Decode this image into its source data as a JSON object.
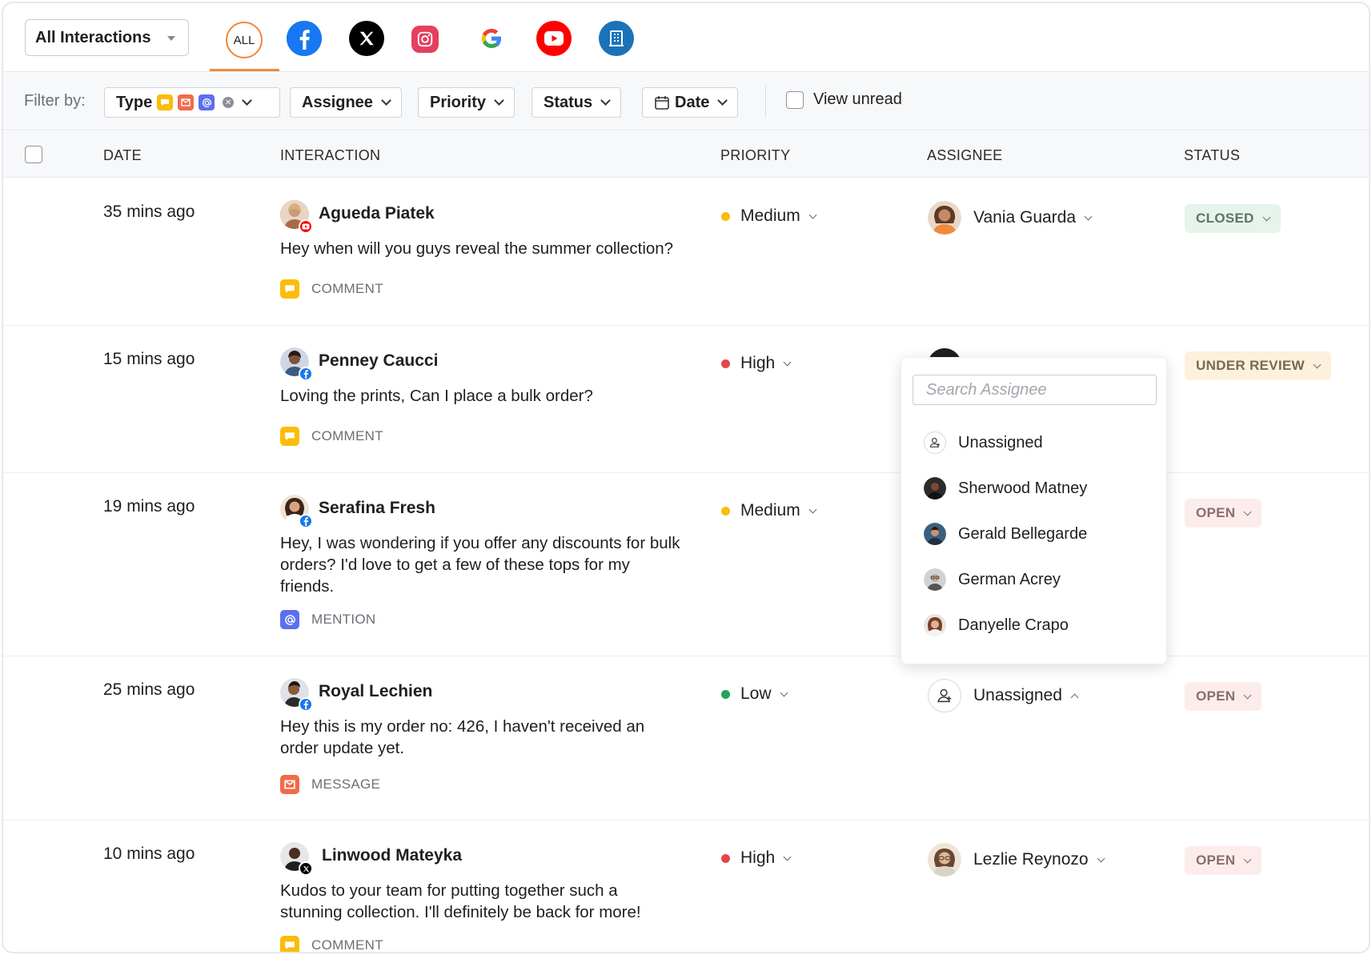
{
  "topbar": {
    "view_select": "All Interactions",
    "channels": [
      {
        "name": "all",
        "label": "ALL"
      },
      {
        "name": "facebook-icon"
      },
      {
        "name": "x-twitter-icon"
      },
      {
        "name": "instagram-icon"
      },
      {
        "name": "google-icon"
      },
      {
        "name": "youtube-icon"
      },
      {
        "name": "building-icon"
      }
    ]
  },
  "filters": {
    "label": "Filter by:",
    "type": "Type",
    "assignee": "Assignee",
    "priority": "Priority",
    "status": "Status",
    "date": "Date",
    "view_unread": "View unread"
  },
  "table": {
    "columns": {
      "date": "DATE",
      "interaction": "INTERACTION",
      "priority": "PRIORITY",
      "assignee": "ASSIGNEE",
      "status": "STATUS"
    },
    "rows": [
      {
        "date": "35 mins ago",
        "name": "Agueda Piatek",
        "channel": "youtube",
        "message": "Hey when will you guys reveal the summer collection?",
        "type": "COMMENT",
        "priority": "Medium",
        "assignee": "Vania Guarda",
        "status": "CLOSED"
      },
      {
        "date": "15 mins ago",
        "name": "Penney Caucci",
        "channel": "facebook",
        "message": "Loving the prints, Can I place a bulk order?",
        "type": "COMMENT",
        "priority": "High",
        "assignee": "",
        "status": "UNDER REVIEW"
      },
      {
        "date": "19 mins ago",
        "name": "Serafina Fresh",
        "channel": "facebook",
        "message": "Hey, I was wondering if you offer any discounts for bulk orders? I'd love to get a few of these tops for my friends.",
        "type": "MENTION",
        "priority": "Medium",
        "assignee": "",
        "status": "OPEN"
      },
      {
        "date": "25 mins ago",
        "name": "Royal Lechien",
        "channel": "facebook",
        "message": "Hey this is my order no: 426, I haven't received an order update yet.",
        "type": "MESSAGE",
        "priority": "Low",
        "assignee": "Unassigned",
        "status": "OPEN"
      },
      {
        "date": "10 mins ago",
        "name": "Linwood Mateyka",
        "channel": "x",
        "message": "Kudos to your team for putting together such a stunning collection. I'll definitely be back for more!",
        "type": "COMMENT",
        "priority": "High",
        "assignee": "Lezlie Reynozo",
        "status": "OPEN"
      }
    ]
  },
  "assignee_dropdown": {
    "placeholder": "Search Assignee",
    "options": [
      "Unassigned",
      "Sherwood Matney",
      "Gerald Bellegarde",
      "German Acrey",
      "Danyelle Crapo"
    ]
  },
  "colors": {
    "accent": "#f08a3c",
    "priority_medium": "#fbbc0a",
    "priority_high": "#e0474c",
    "priority_low": "#22a55a",
    "comment": "#fbbc0a",
    "message": "#f26b4a",
    "mention": "#5b6ff0"
  }
}
